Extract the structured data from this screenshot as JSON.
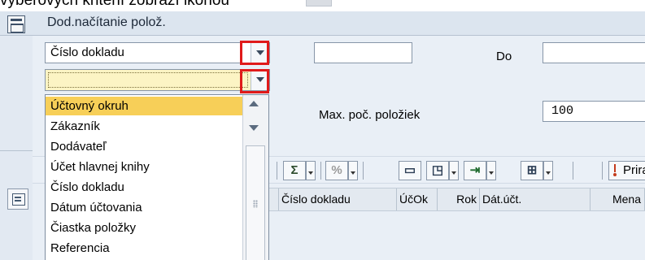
{
  "top_caption": "výberových kritérií zobrazí ikonou",
  "panel": {
    "title": "Dod.načítanie polož."
  },
  "criteria": {
    "field_select": {
      "value": "Číslo dokladu"
    },
    "to_label": "Do",
    "max_items_label": "Max. poč. položiek",
    "max_items_value": "100"
  },
  "dropdown": {
    "options": [
      {
        "label": "Účtovný okruh",
        "selected": true
      },
      {
        "label": "Zákazník",
        "selected": false
      },
      {
        "label": "Dodávateľ",
        "selected": false
      },
      {
        "label": "Účet hlavnej knihy",
        "selected": false
      },
      {
        "label": "Číslo dokladu",
        "selected": false
      },
      {
        "label": "Dátum účtovania",
        "selected": false
      },
      {
        "label": "Čiastka položky",
        "selected": false
      },
      {
        "label": "Referencia",
        "selected": false
      }
    ]
  },
  "toolbar": {
    "assign_label": "Priraď",
    "icons": [
      "sum-icon",
      "subtotal-icon",
      "print-icon",
      "view-icon",
      "export-icon",
      "layout-icon",
      "assign-icon"
    ]
  },
  "grid": {
    "columns": [
      "Číslo dokladu",
      "ÚčOk",
      "Rok",
      "Dát.účt.",
      "Mena"
    ]
  },
  "colors": {
    "highlight": "#f7cf58",
    "input_active": "#fcf4c4",
    "annotation_red": "#e01a1a",
    "panel_header": "#dce5ef"
  }
}
